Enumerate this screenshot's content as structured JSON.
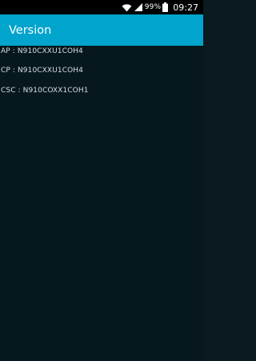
{
  "status_bar": {
    "battery_percent": "99%",
    "time": "09:27",
    "icons": [
      "wifi-icon",
      "signal-icon",
      "battery-icon"
    ]
  },
  "app_bar": {
    "title": "Version",
    "color": "#00a4cc"
  },
  "versions": [
    {
      "text": "AP : N910CXXU1COH4"
    },
    {
      "text": "CP : N910CXXU1COH4"
    },
    {
      "text": "CSC : N910COXX1COH1"
    }
  ]
}
